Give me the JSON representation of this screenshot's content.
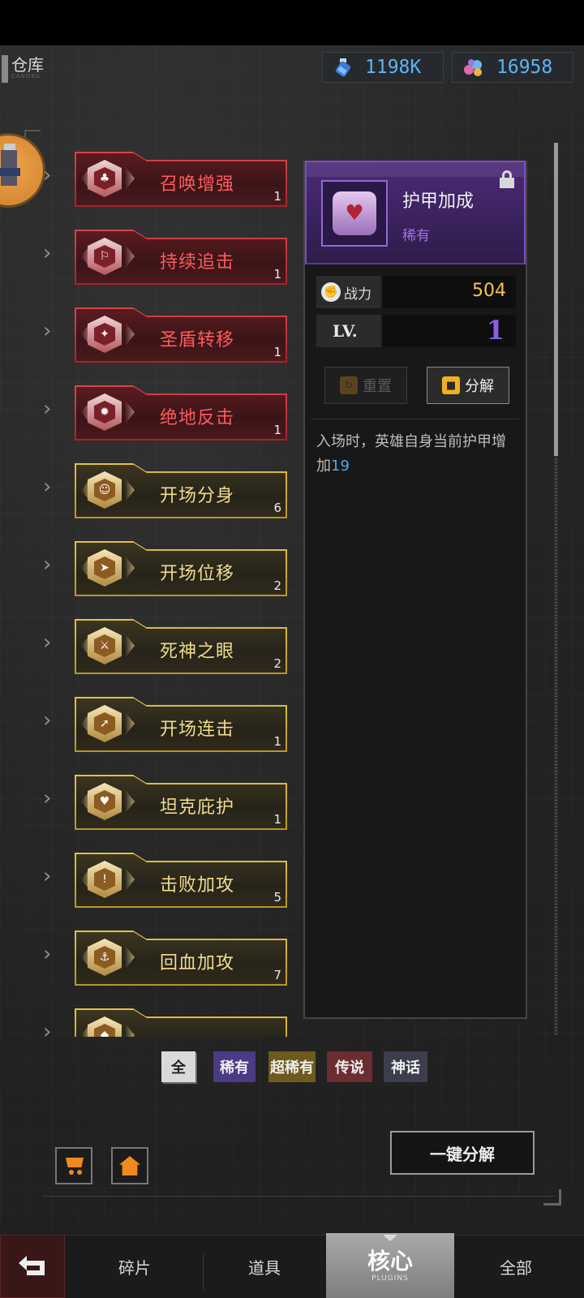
{
  "header": {
    "title": "仓库",
    "title_sub": "CANGKU",
    "currency_1": {
      "icon": "potion-bottle-icon",
      "value": "1198K"
    },
    "currency_2": {
      "icon": "gem-pile-icon",
      "value": "16958"
    }
  },
  "plugins": [
    {
      "name": "召唤增强",
      "count": "1",
      "rarity": "legendary",
      "icon": "summon-icon"
    },
    {
      "name": "持续追击",
      "count": "1",
      "rarity": "legendary",
      "icon": "chase-icon"
    },
    {
      "name": "圣盾转移",
      "count": "1",
      "rarity": "legendary",
      "icon": "holy-shield-icon"
    },
    {
      "name": "绝地反击",
      "count": "1",
      "rarity": "legendary",
      "icon": "counterattack-icon"
    },
    {
      "name": "开场分身",
      "count": "6",
      "rarity": "super-rare",
      "icon": "clone-icon"
    },
    {
      "name": "开场位移",
      "count": "2",
      "rarity": "super-rare",
      "icon": "dash-icon"
    },
    {
      "name": "死神之眼",
      "count": "2",
      "rarity": "super-rare",
      "icon": "death-eye-icon"
    },
    {
      "name": "开场连击",
      "count": "1",
      "rarity": "super-rare",
      "icon": "combo-icon"
    },
    {
      "name": "坦克庇护",
      "count": "1",
      "rarity": "super-rare",
      "icon": "tank-icon"
    },
    {
      "name": "击败加攻",
      "count": "5",
      "rarity": "super-rare",
      "icon": "sword-icon"
    },
    {
      "name": "回血加攻",
      "count": "7",
      "rarity": "super-rare",
      "icon": "anchor-icon"
    },
    {
      "name": "",
      "count": "",
      "rarity": "super-rare",
      "icon": "partial-icon"
    }
  ],
  "detail": {
    "name": "护甲加成",
    "rarity": "稀有",
    "icon": "armor-heart-icon",
    "lock_icon": "unlock-icon",
    "power_label": "战力",
    "power_value": "504",
    "level_label": "LV.",
    "level_value": "1",
    "reset_label": "重置",
    "decompose_label": "分解",
    "description": "入场时，英雄自身当前护甲增加",
    "description_value": "19"
  },
  "filters": {
    "all": "全",
    "rare": "稀有",
    "super_rare": "超稀有",
    "legendary": "传说",
    "mythic": "神话"
  },
  "actions": {
    "shop_icon": "cart-icon",
    "home_icon": "home-icon",
    "one_key_decompose": "一键分解"
  },
  "tabs": {
    "fragments": "碎片",
    "items": "道具",
    "core": "核心",
    "core_sub": "PLUGINS",
    "all": "全部"
  },
  "colors": {
    "legendary": "#d8444b",
    "super_rare": "#e3c245",
    "rare": "#7a4fc2",
    "currency": "#5fb3f0",
    "power": "#f6c34d",
    "level": "#8a5ee8"
  }
}
